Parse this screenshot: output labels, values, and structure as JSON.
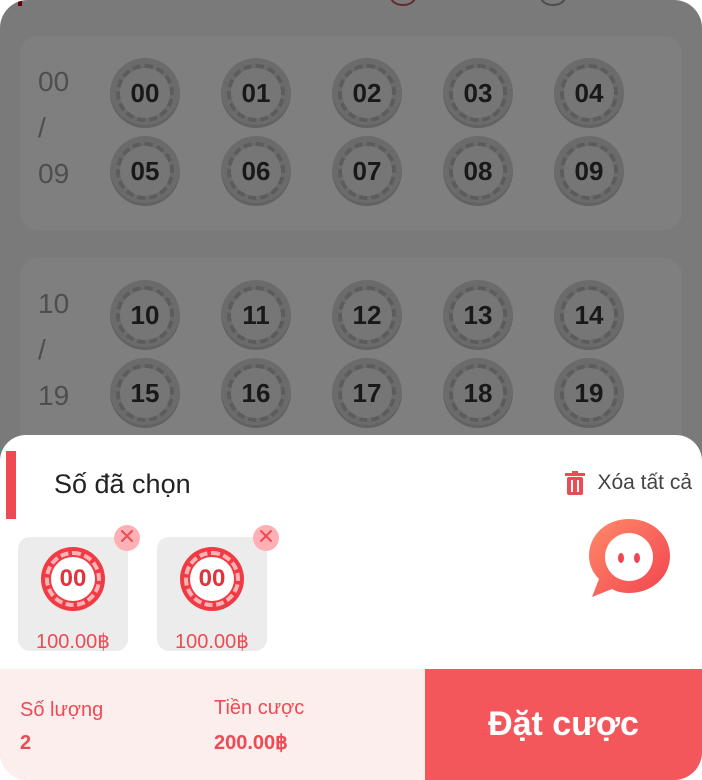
{
  "background": {
    "groups": [
      {
        "range_start": "00",
        "range_sep": "/",
        "range_end": "09",
        "numbers": [
          "00",
          "01",
          "02",
          "03",
          "04",
          "05",
          "06",
          "07",
          "08",
          "09"
        ]
      },
      {
        "range_start": "10",
        "range_sep": "/",
        "range_end": "19",
        "numbers": [
          "10",
          "11",
          "12",
          "13",
          "14",
          "15",
          "16",
          "17",
          "18",
          "19"
        ]
      }
    ]
  },
  "sheet": {
    "title": "Số đã chọn",
    "clear_all_label": "Xóa tất cả",
    "clear_icon": "trash-icon",
    "selected": [
      {
        "number": "00",
        "amount": "100.00฿"
      },
      {
        "number": "00",
        "amount": "100.00฿"
      }
    ],
    "support_icon": "chat-support-icon"
  },
  "footer": {
    "quantity_label": "Số lượng",
    "quantity_value": "2",
    "stake_label": "Tiền cược",
    "stake_value": "200.00฿",
    "bet_button_label": "Đặt cược"
  },
  "colors": {
    "accent": "#ef4a53",
    "bet_button": "#f4575b",
    "footer_bg": "#fdeeee",
    "overlay": "rgba(0,0,0,0.5)"
  }
}
